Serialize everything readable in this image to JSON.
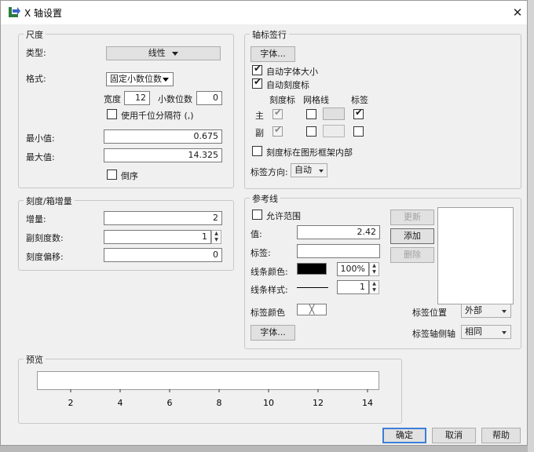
{
  "window": {
    "title": "X 轴设置"
  },
  "scale": {
    "group_title": "尺度",
    "type_label": "类型:",
    "type_value": "线性",
    "format_label": "格式:",
    "format_value": "固定小数位数",
    "width_label": "宽度",
    "width_value": "12",
    "decimals_label": "小数位数",
    "decimals_value": "0",
    "thousands_label": "使用千位分隔符 (,)",
    "min_label": "最小值:",
    "min_value": "0.675",
    "max_label": "最大值:",
    "max_value": "14.325",
    "reverse_label": "倒序"
  },
  "tick": {
    "group_title": "刻度/箱增量",
    "increment_label": "增量:",
    "increment_value": "2",
    "minor_label": "副刻度数:",
    "minor_value": "1",
    "offset_label": "刻度偏移:",
    "offset_value": "0"
  },
  "axis_label_row": {
    "group_title": "轴标签行",
    "font_button": "字体...",
    "auto_font_size": "自动字体大小",
    "auto_ticks": "自动刻度标",
    "col_tick": "刻度标",
    "col_grid": "网格线",
    "col_label": "标签",
    "row_major": "主",
    "row_minor": "副",
    "tick_inside": "刻度标在图形框架内部",
    "label_dir_label": "标签方向:",
    "label_dir_value": "自动"
  },
  "ref_line": {
    "group_title": "参考线",
    "allow_range": "允许范围",
    "update_button": "更新",
    "add_button": "添加",
    "delete_button": "删除",
    "value_label": "值:",
    "value": "2.42",
    "label_label": "标签:",
    "label_value": "",
    "line_color_label": "线条颜色:",
    "line_color": "#000000",
    "opacity_value": "100%",
    "line_style_label": "线条样式:",
    "line_width_value": "1",
    "label_color_label": "标签颜色",
    "label_pos_label": "标签位置",
    "label_pos_value": "外部",
    "label_side_label": "标签轴侧轴",
    "label_side_value": "相同",
    "font_button": "字体..."
  },
  "preview": {
    "group_title": "预览",
    "ticks": [
      "2",
      "4",
      "6",
      "8",
      "10",
      "12",
      "14"
    ]
  },
  "footer": {
    "ok": "确定",
    "cancel": "取消",
    "help": "帮助"
  }
}
